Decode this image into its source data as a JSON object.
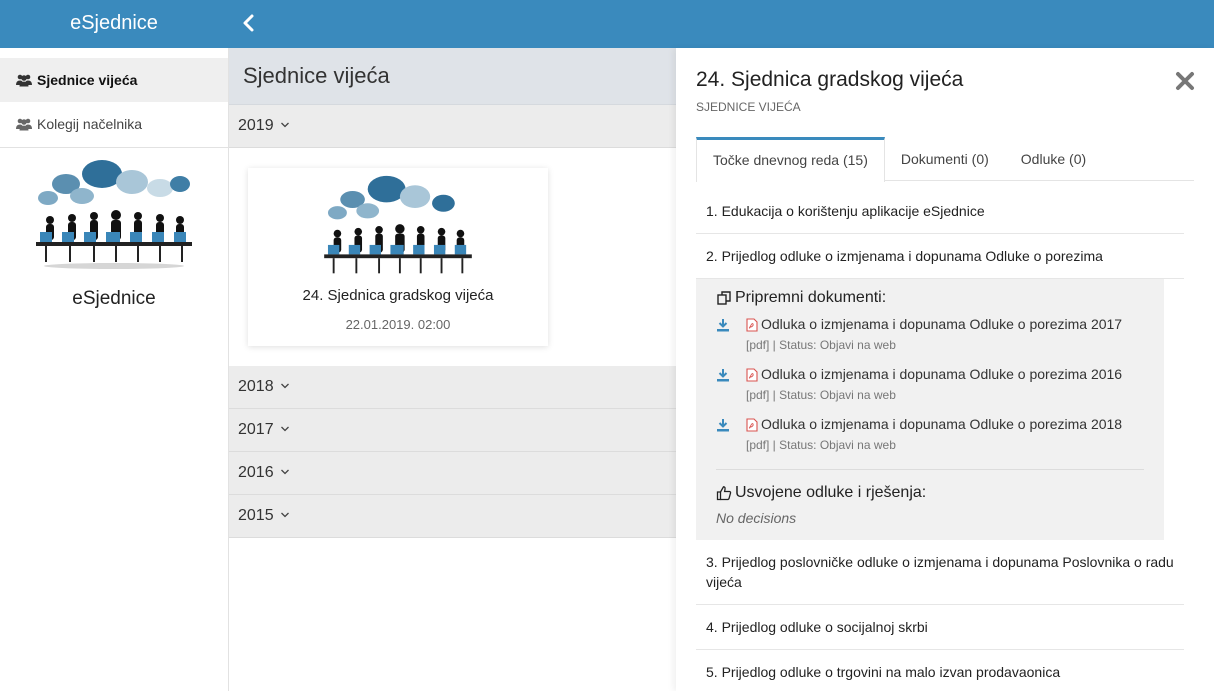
{
  "app": {
    "brand": "eSjednice"
  },
  "sidebar": {
    "items": [
      {
        "label": "Sjednice vijeća",
        "icon": "users-icon",
        "active": true
      },
      {
        "label": "Kolegij načelnika",
        "icon": "users-icon",
        "active": false
      }
    ],
    "app_name": "eSjednice"
  },
  "middle": {
    "title": "Sjednice vijeća",
    "years": [
      "2019",
      "2018",
      "2017",
      "2016",
      "2015"
    ],
    "card": {
      "title": "24. Sjednica gradskog vijeća",
      "date": "22.01.2019. 02:00"
    }
  },
  "detail": {
    "title": "24. Sjednica gradskog vijeća",
    "subtitle": "SJEDNICE VIJEĆA",
    "tabs": [
      {
        "label": "Točke dnevnog reda (15)",
        "active": true
      },
      {
        "label": "Dokumenti (0)",
        "active": false
      },
      {
        "label": "Odluke (0)",
        "active": false
      }
    ],
    "agenda": [
      "1. Edukacija o korištenju aplikacije eSjednice",
      "2. Prijedlog odluke o izmjenama i dopunama Odluke o porezima",
      "3. Prijedlog poslovničke odluke o izmjenama i dopunama Poslovnika o radu vijeća",
      "4. Prijedlog odluke o socijalnoj skrbi",
      "5. Prijedlog odluke o trgovini na malo izvan prodavaonica"
    ],
    "expanded": {
      "prep_heading": "Pripremni dokumenti:",
      "documents": [
        {
          "name": "Odluka o izmjenama i dopunama Odluke o porezima 2017",
          "meta": "[pdf] | Status: Objavi na web"
        },
        {
          "name": "Odluka o izmjenama i dopunama Odluke o porezima 2016",
          "meta": "[pdf] | Status: Objavi na web"
        },
        {
          "name": "Odluka o izmjenama i dopunama Odluke o porezima 2018",
          "meta": "[pdf] | Status: Objavi na web"
        }
      ],
      "decisions_heading": "Usvojene odluke i rješenja:",
      "no_decisions": "No decisions"
    }
  },
  "colors": {
    "accent": "#3a8abd",
    "panel_bg": "#dfe3e8",
    "year_bg": "#ececec"
  }
}
